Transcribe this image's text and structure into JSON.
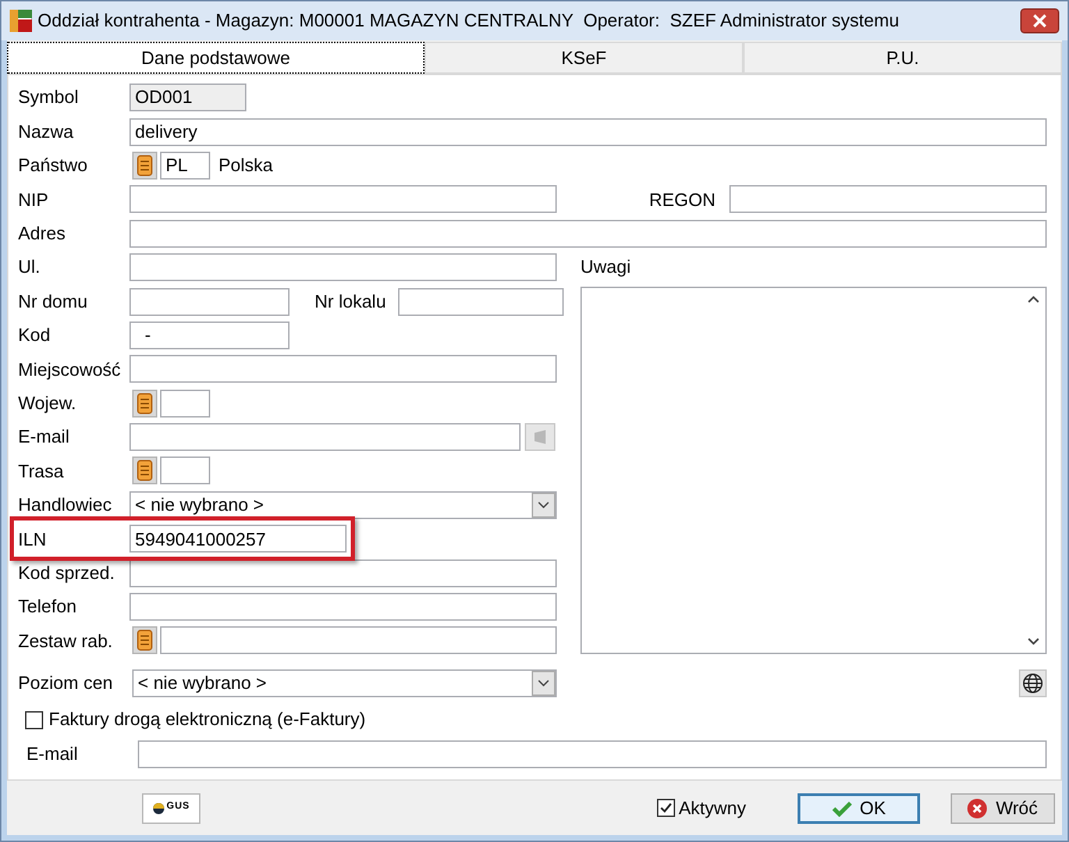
{
  "window": {
    "title": "Oddział kontrahenta - Magazyn: M00001 MAGAZYN CENTRALNY  Operator:  SZEF Administrator systemu"
  },
  "tabs": [
    {
      "label": "Dane podstawowe",
      "selected": true
    },
    {
      "label": "KSeF",
      "selected": false
    },
    {
      "label": "P.U.",
      "selected": false
    }
  ],
  "form": {
    "symbol": {
      "label": "Symbol",
      "value": "OD001"
    },
    "nazwa": {
      "label": "Nazwa",
      "value": "delivery"
    },
    "panstwo": {
      "label": "Państwo",
      "code": "PL",
      "name": "Polska"
    },
    "nip": {
      "label": "NIP"
    },
    "regon": {
      "label": "REGON"
    },
    "adres": {
      "label": "Adres"
    },
    "ul": {
      "label": "Ul."
    },
    "nr_domu": {
      "label": "Nr domu"
    },
    "nr_lokalu": {
      "label": "Nr lokalu"
    },
    "kod": {
      "label": "Kod",
      "value": "-"
    },
    "miejscowosc": {
      "label": "Miejscowość"
    },
    "wojew": {
      "label": "Wojew."
    },
    "email": {
      "label": "E-mail"
    },
    "trasa": {
      "label": "Trasa"
    },
    "handlowiec": {
      "label": "Handlowiec",
      "value": "< nie wybrano >"
    },
    "iln": {
      "label": "ILN",
      "value": "5949041000257",
      "highlighted": true
    },
    "kod_sprzed": {
      "label": "Kod sprzed."
    },
    "telefon": {
      "label": "Telefon"
    },
    "zestaw_rab": {
      "label": "Zestaw rab."
    },
    "uwagi": {
      "label": "Uwagi"
    },
    "poziom_cen": {
      "label": "Poziom cen",
      "value": "< nie wybrano >"
    },
    "e_faktury": {
      "label": "Faktury drogą elektroniczną (e-Faktury)",
      "checked": false
    },
    "e_faktury_email": {
      "label": "E-mail"
    }
  },
  "footer": {
    "gus": "GUS",
    "aktywny": {
      "label": "Aktywny",
      "checked": true
    },
    "buttons": [
      {
        "label": "OK",
        "kind": "ok"
      },
      {
        "label": "Wróć",
        "kind": "cancel"
      }
    ]
  }
}
